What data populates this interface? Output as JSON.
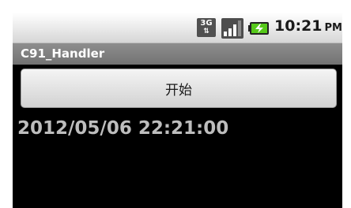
{
  "status_bar": {
    "network_type": "3G",
    "network_arrows": "⇅",
    "time": "10:21",
    "ampm": "PM",
    "icons": [
      "3g-icon",
      "signal-strength-icon",
      "battery-charging-icon"
    ],
    "battery_color": "#56c91a"
  },
  "title_bar": {
    "title": "C91_Handler"
  },
  "main": {
    "start_button_label": "开始",
    "datetime": "2012/05/06 22:21:00"
  }
}
